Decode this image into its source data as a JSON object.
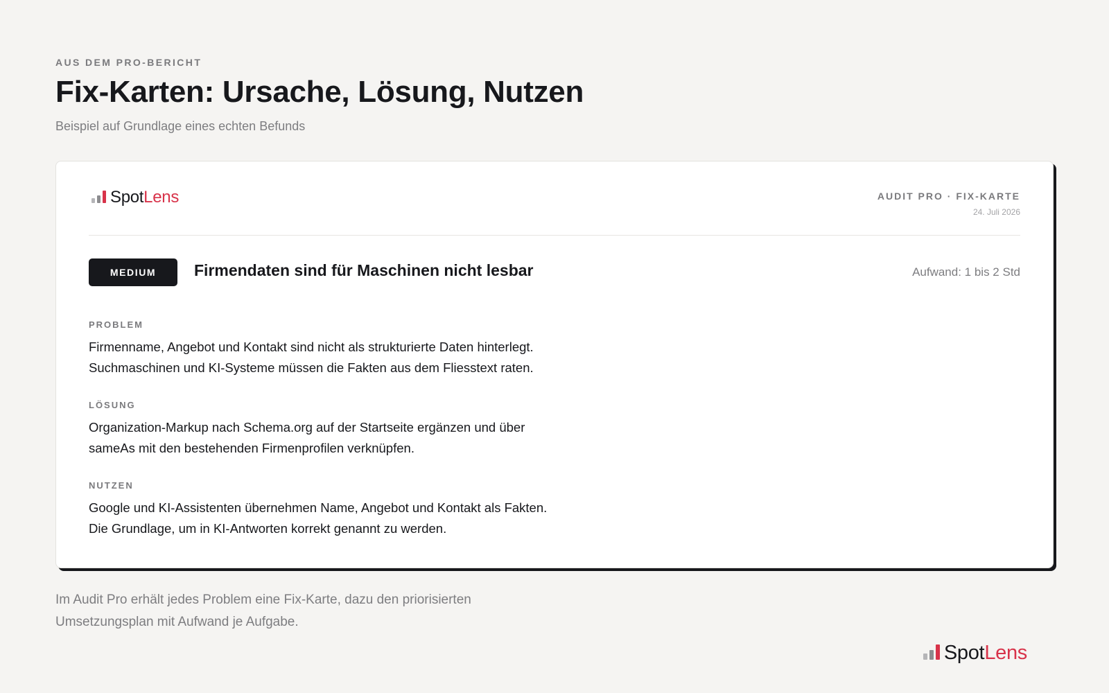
{
  "header": {
    "eyebrow": "AUS DEM PRO-BERICHT",
    "title": "Fix-Karten: Ursache, Lösung, Nutzen",
    "subtitle": "Beispiel auf Grundlage eines echten Befunds"
  },
  "brand": {
    "part1": "Spot",
    "part2": "Lens",
    "accent_color": "#d8334a",
    "bar_colors": [
      "#b5b5b8",
      "#8d8d90",
      "#d8334a"
    ]
  },
  "card": {
    "meta_label": "AUDIT PRO · FIX-KARTE",
    "date": "24. Juli 2026",
    "severity": "MEDIUM",
    "issue_title": "Firmendaten sind für Maschinen nicht lesbar",
    "effort": "Aufwand: 1 bis 2 Std",
    "sections": [
      {
        "label": "PROBLEM",
        "lines": [
          "Firmenname, Angebot und Kontakt sind nicht als strukturierte Daten hinterlegt.",
          "Suchmaschinen und KI-Systeme müssen die Fakten aus dem Fliesstext raten."
        ]
      },
      {
        "label": "LÖSUNG",
        "lines": [
          "Organization-Markup nach Schema.org auf der Startseite ergänzen und über",
          "sameAs mit den bestehenden Firmenprofilen verknüpfen."
        ]
      },
      {
        "label": "NUTZEN",
        "lines": [
          "Google und KI-Assistenten übernehmen Name, Angebot und Kontakt als Fakten.",
          "Die Grundlage, um in KI-Antworten korrekt genannt zu werden."
        ]
      }
    ]
  },
  "footer": {
    "lines": [
      "Im Audit Pro erhält jedes Problem eine Fix-Karte, dazu den priorisierten",
      "Umsetzungsplan mit Aufwand je Aufgabe."
    ]
  }
}
